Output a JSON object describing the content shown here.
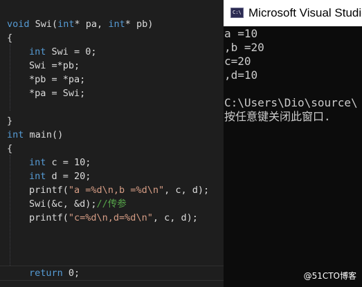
{
  "editor": {
    "line1": {
      "kw_void": "void",
      "fn_swi": " Swi(",
      "kw_int_a": "int",
      "param_a": "* pa, ",
      "kw_int_b": "int",
      "param_b": "* pb)"
    },
    "line2": "{",
    "line3": {
      "kw_int": "int",
      "rest": " Swi = 0;"
    },
    "line4": "Swi =*pb;",
    "line5": "*pb = *pa;",
    "line6": "*pa = Swi;",
    "line7": "}",
    "line8": {
      "kw_int": "int",
      "rest": " main()"
    },
    "line9": "{",
    "line10": {
      "kw_int": "int",
      "rest": " c = 10;"
    },
    "line11": {
      "kw_int": "int",
      "rest": " d = 20;"
    },
    "line12": {
      "call": "printf(",
      "string": "\"a =%d\\n,b =%d\\n\"",
      "args": ", c, d);"
    },
    "line13": {
      "code": "Swi(&c, &d);",
      "comment": "//传参"
    },
    "line14": {
      "call": "printf(",
      "string": "\"c=%d\\n,d=%d\\n\"",
      "args": ", c, d);"
    },
    "line15": {
      "kw_return": "return",
      "rest": " 0;"
    }
  },
  "console": {
    "icon_label": "C:\\",
    "title": "Microsoft Visual Studio",
    "lines": [
      "a =10",
      ",b =20",
      "c=20",
      ",d=10",
      "",
      "C:\\Users\\Dio\\source\\",
      "按任意键关闭此窗口. "
    ]
  },
  "watermark": "@51CTO博客",
  "colors": {
    "editor_bg": "#1e1e1e",
    "keyword": "#569cd6",
    "string": "#d69d85",
    "comment": "#57a64a",
    "console_bg": "#0c0c0c",
    "console_text": "#cccccc"
  }
}
